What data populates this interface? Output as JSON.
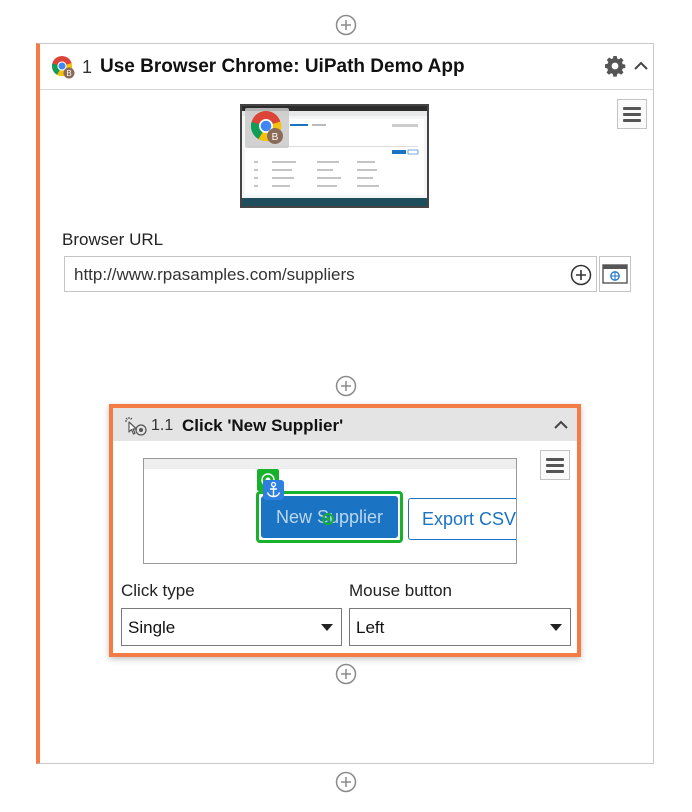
{
  "outer_activity": {
    "step": "1",
    "title": "Use Browser Chrome: UiPath Demo App",
    "thumbnail_badge": "B",
    "url_label": "Browser URL",
    "url_value": "http://www.rpasamples.com/suppliers"
  },
  "inner_activity": {
    "step": "1.1",
    "title": "Click 'New Supplier'",
    "target_button": "New Supplier",
    "neighbor_button": "Export CSV",
    "click_type_label": "Click type",
    "click_type_value": "Single",
    "mouse_button_label": "Mouse button",
    "mouse_button_value": "Left"
  },
  "colors": {
    "accent": "#f47b43",
    "target_outline": "#17b12b",
    "button_blue": "#1a73c3",
    "anchor_blue": "#2d7fe0"
  },
  "icons": [
    "add-circle-icon",
    "chrome-icon",
    "gear-icon",
    "chevron-up-icon",
    "menu-icon",
    "browser-window-icon",
    "click-icon",
    "target-icon",
    "anchor-icon",
    "chevron-down-icon"
  ]
}
